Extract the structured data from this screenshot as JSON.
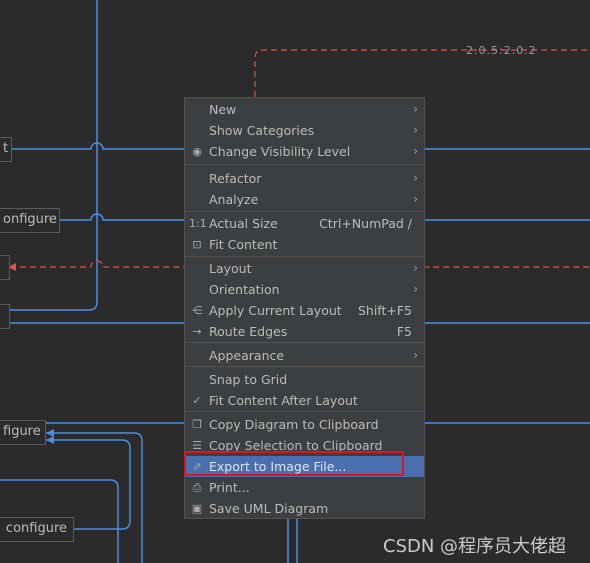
{
  "diagram": {
    "nodes": [
      "t",
      "onfigure",
      "",
      "",
      "figure",
      "configure"
    ],
    "edge_label": "2.0.5:2.0.2",
    "colors": {
      "background": "#2b2b2b",
      "edge": "#4a8fe7",
      "dashed_edge": "#e05050"
    }
  },
  "menu": {
    "items": [
      {
        "label": "New",
        "submenu": true
      },
      {
        "label": "Show Categories",
        "submenu": true
      },
      {
        "label": "Change Visibility Level",
        "icon": "eye-icon",
        "submenu": true
      },
      {
        "label": "Refactor",
        "submenu": true
      },
      {
        "label": "Analyze",
        "submenu": true
      },
      {
        "label": "Actual Size",
        "icon": "actual-size-icon",
        "icon_text": "1:1",
        "shortcut": "Ctrl+NumPad /"
      },
      {
        "label": "Fit Content",
        "icon": "fit-content-icon"
      },
      {
        "label": "Layout",
        "submenu": true
      },
      {
        "label": "Orientation",
        "submenu": true
      },
      {
        "label": "Apply Current Layout",
        "icon": "layout-icon",
        "shortcut": "Shift+F5"
      },
      {
        "label": "Route Edges",
        "icon": "route-edges-icon",
        "shortcut": "F5"
      },
      {
        "label": "Appearance",
        "submenu": true
      },
      {
        "label": "Snap to Grid"
      },
      {
        "label": "Fit Content After Layout",
        "icon": "check-icon",
        "checked": true
      },
      {
        "label": "Copy Diagram to Clipboard",
        "icon": "copy-icon"
      },
      {
        "label": "Copy Selection to Clipboard",
        "icon": "copy-selection-icon"
      },
      {
        "label": "Export to Image File...",
        "icon": "export-icon",
        "selected": true
      },
      {
        "label": "Print...",
        "icon": "print-icon"
      },
      {
        "label": "Save UML Diagram",
        "icon": "save-icon"
      }
    ],
    "arrow": "›",
    "selected_color": "#4b6eaf",
    "highlight_box_color": "#e0141e"
  },
  "watermark": "CSDN @程序员大佬超"
}
